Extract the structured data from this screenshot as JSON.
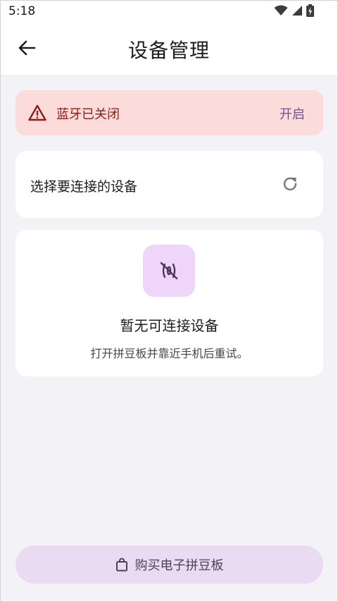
{
  "status_bar": {
    "time": "5:18",
    "icons": [
      "wifi-icon",
      "signal-icon",
      "battery-charging-icon"
    ]
  },
  "app_bar": {
    "title": "设备管理",
    "back_icon": "arrow-left-icon"
  },
  "alert": {
    "icon": "warning-icon",
    "message": "蓝牙已关闭",
    "action_label": "开启"
  },
  "device_select": {
    "label": "选择要连接的设备",
    "refresh_icon": "refresh-icon"
  },
  "empty_state": {
    "icon": "signal-off-icon",
    "title": "暂无可连接设备",
    "hint": "打开拼豆板并靠近手机后重试。"
  },
  "buy_button": {
    "icon": "shopping-bag-icon",
    "label": "购买电子拼豆板"
  },
  "colors": {
    "background": "#f3f2f7",
    "alert_background": "#fcdcda",
    "alert_text": "#8c1d18",
    "accent": "#6e4f97",
    "empty_icon_background": "#f0d5fb",
    "button_background": "#eadaf2"
  }
}
